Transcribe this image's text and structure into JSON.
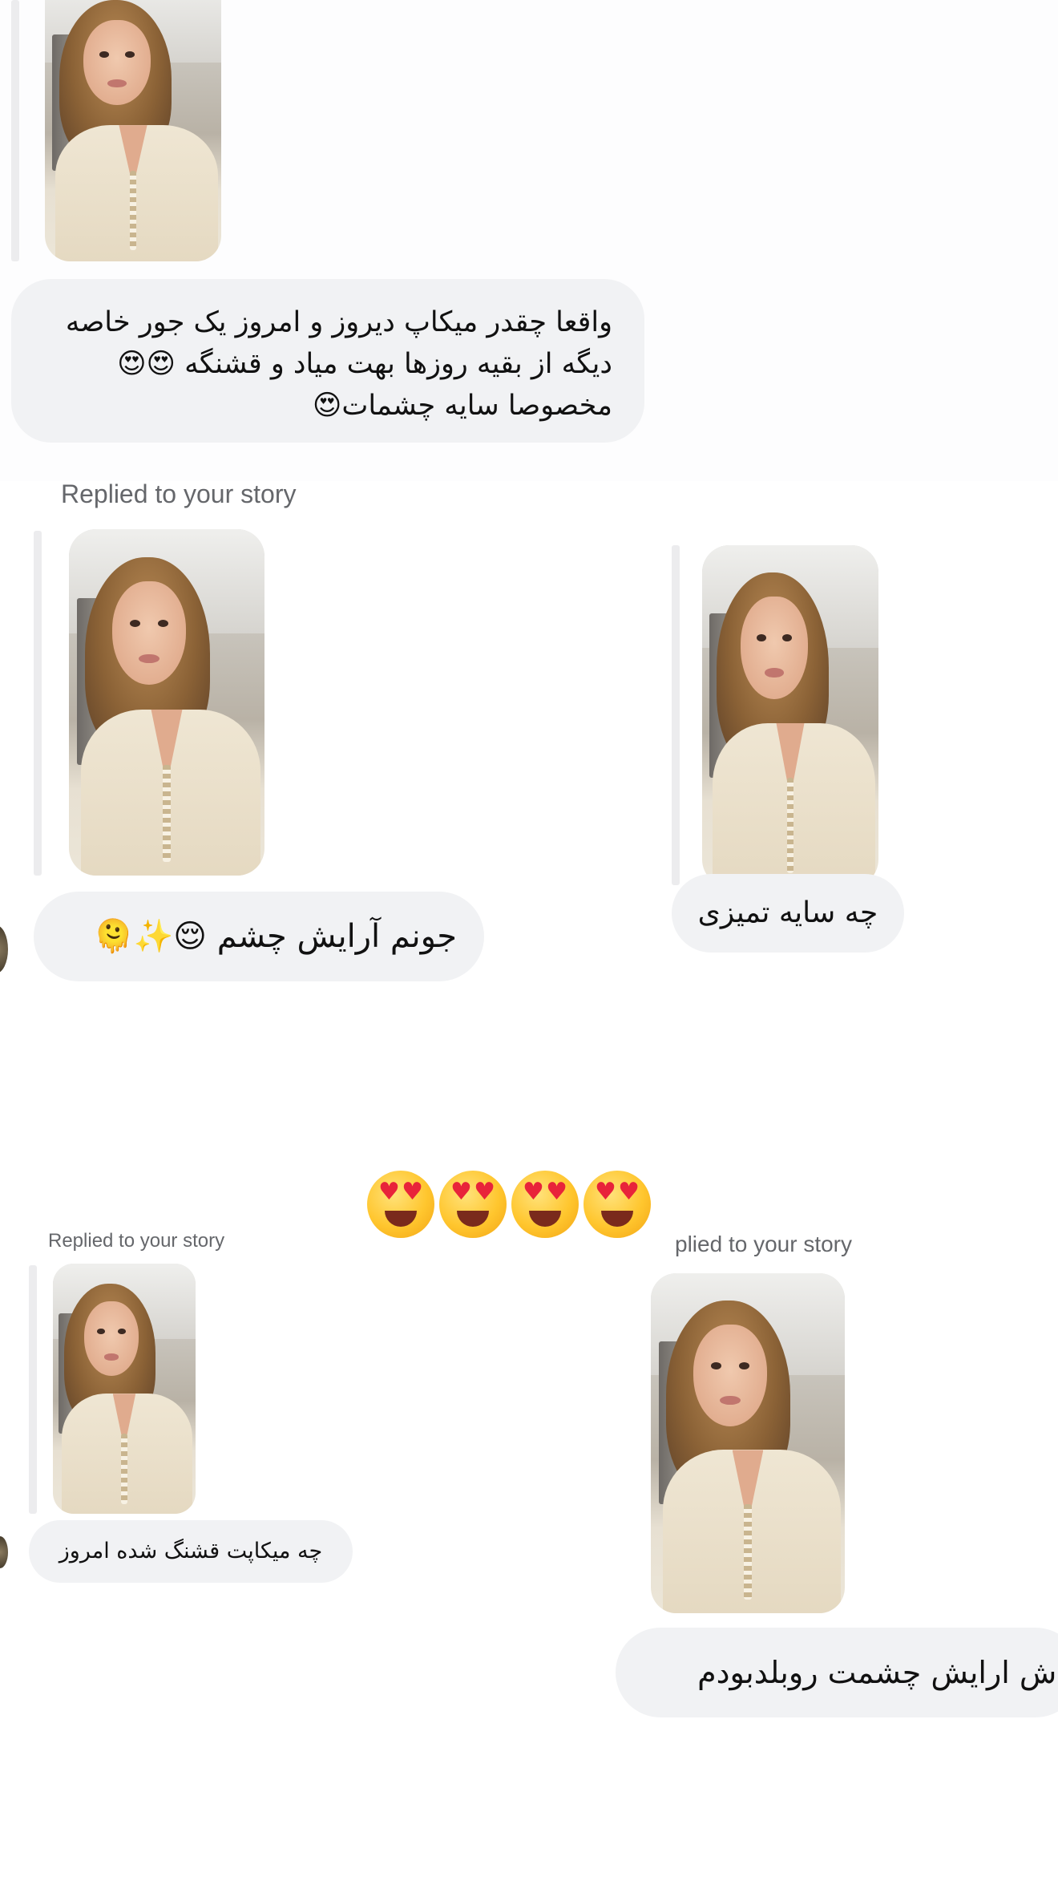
{
  "replied_label": "Replied to your story",
  "replied_label_cut_top": "Replied to your story",
  "replied_label_cut_mid": "plied to your story",
  "messages": {
    "m1": "واقعا چقدر میکاپ دیروز و امروز یک جور خاصه دیگه از بقیه روزها بهت میاد و قشنگه 😍😍 مخصوصا سایه چشمات😍",
    "m2": "جونم آرایش چشم 😌✨🫠",
    "m3": "چه سایه تمیزی",
    "m4": "😍😍😍😍",
    "m5": "چه میکاپت قشنگ شده امروز",
    "m6": "کاش ارایش چشمت روبلدبودم"
  },
  "icons": [
    "heart-eyes-emoji",
    "relieved-face-emoji",
    "sparkles-emoji",
    "melting-face-emoji"
  ]
}
